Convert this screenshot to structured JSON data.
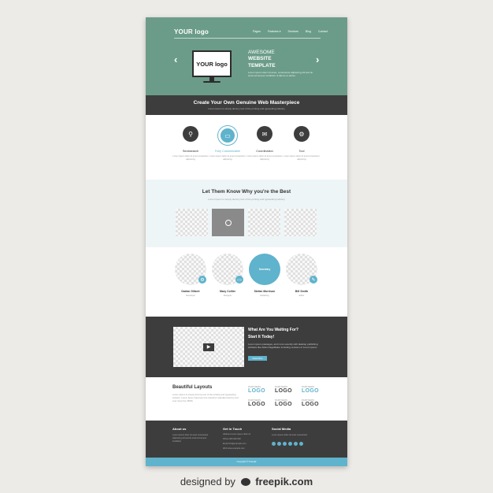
{
  "hero": {
    "logo": "YOUR logo",
    "nav": [
      "Pages",
      "Features ▾",
      "Services",
      "Blog",
      "Contact"
    ],
    "prev": "‹",
    "next": "›",
    "monitor_logo": "YOUR logo",
    "title_line1": "AWESOME",
    "title_line2": "WEBSITE",
    "title_line3": "TEMPLATE",
    "blurb": "Lorem ipsum dolor sit amet, consectetur adipiscing elit sed do eiusmod tempor incididunt ut labore et dolore"
  },
  "banner": {
    "title": "Create Your Own Genuine Web Masterpiece",
    "subtitle": "Lorem Ipsum is simply dummy text of the printing and typesetting industry"
  },
  "features": [
    {
      "icon": "search-icon",
      "label": "Seobsearch",
      "desc": "Lorem ipsum dolor sit amet consectetur adipiscing"
    },
    {
      "icon": "monitor-icon",
      "label": "Fully Customizable",
      "desc": "Lorem ipsum dolor sit amet consectetur adipiscing"
    },
    {
      "icon": "chat-icon",
      "label": "Coordination",
      "desc": "Lorem ipsum dolor sit amet consectetur adipiscing"
    },
    {
      "icon": "gear-icon",
      "label": "Tool",
      "desc": "Lorem ipsum dolor sit amet consectetur adipiscing"
    }
  ],
  "portfolio": {
    "title": "Let Them Know Why you're the Best",
    "subtitle": "Lorem Ipsum is simply dummy text of the printing and typesetting industry"
  },
  "team": [
    {
      "name": "Darlan Gilbert",
      "role": "Developer"
    },
    {
      "name": "Mary Collier",
      "role": "Designer"
    },
    {
      "name": "Stefan Morrison",
      "role": "Marketing",
      "overlay": "Secretary"
    },
    {
      "name": "Bill Smith",
      "role": "Editor"
    }
  ],
  "video": {
    "title1": "What Are You Waiting For?",
    "title2": "Start It Today!",
    "text": "Lorem ipsum passages, and more recently with desktop publishing software like Aldus PageMaker including versions of Lorem Ipsum",
    "button": "Read More"
  },
  "layouts": {
    "title": "Beautiful Layouts",
    "text": "Lorem Ipsum is simply dummy text of the printing and typesetting industry. Lorem Ipsum has been the industry's standard dummy text ever since the 1500s",
    "partner_prefix": "PARTNERS",
    "partner_logo": "LOGO"
  },
  "footer": {
    "about_title": "About us",
    "about_text": "Lorem ipsum dolor sit amet consectetur adipiscing elit sed do eiusmod tempor incididunt",
    "contact_title": "Get in Touch",
    "contact_lines": [
      "Address   Lorem ipsum dolor sit",
      "Phone   000 000 000",
      "Email   info@example.com",
      "Web   www.example.com"
    ],
    "social_title": "Social Media",
    "social_text": "Lorem ipsum dolor sit amet consectetur",
    "copyright": "Copyright © Freepik"
  },
  "credit": {
    "designed_by": "designed by",
    "brand": "freepik.com"
  },
  "colors": {
    "hero": "#6b9c89",
    "dark": "#3d3d3d",
    "accent": "#5fb3cc"
  }
}
